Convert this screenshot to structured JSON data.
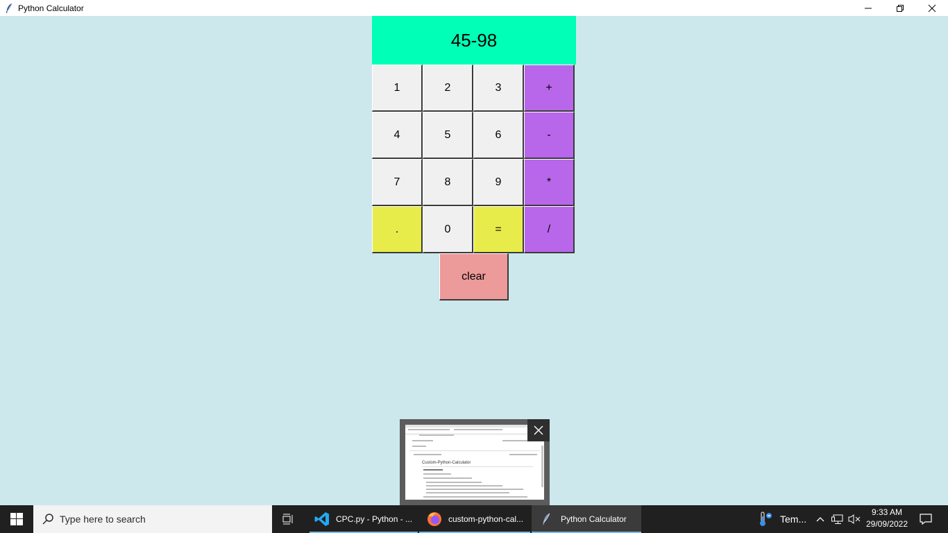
{
  "window": {
    "title": "Python Calculator"
  },
  "calculator": {
    "display": "45-98",
    "keys": {
      "k1": "1",
      "k2": "2",
      "k3": "3",
      "plus": "+",
      "k4": "4",
      "k5": "5",
      "k6": "6",
      "minus": "-",
      "k7": "7",
      "k8": "8",
      "k9": "9",
      "multiply": "*",
      "dot": ".",
      "k0": "0",
      "equals": "=",
      "divide": "/",
      "clear": "clear"
    },
    "colors": {
      "display_bg": "#00ffb7",
      "digit_bg": "#f0f0f0",
      "operator_bg": "#b866ea",
      "special_bg": "#e8ec4a",
      "clear_bg": "#ec9a9a",
      "window_bg": "#cce8ec"
    }
  },
  "taskbar": {
    "search_placeholder": "Type here to search",
    "apps": {
      "vscode": "CPC.py - Python - ...",
      "firefox": "custom-python-cal...",
      "calculator": "Python Calculator"
    },
    "weather_label": "Tem...",
    "time": "9:33 AM",
    "date": "29/09/2022"
  },
  "preview": {
    "heading": "Custom-Python-Calculator"
  }
}
